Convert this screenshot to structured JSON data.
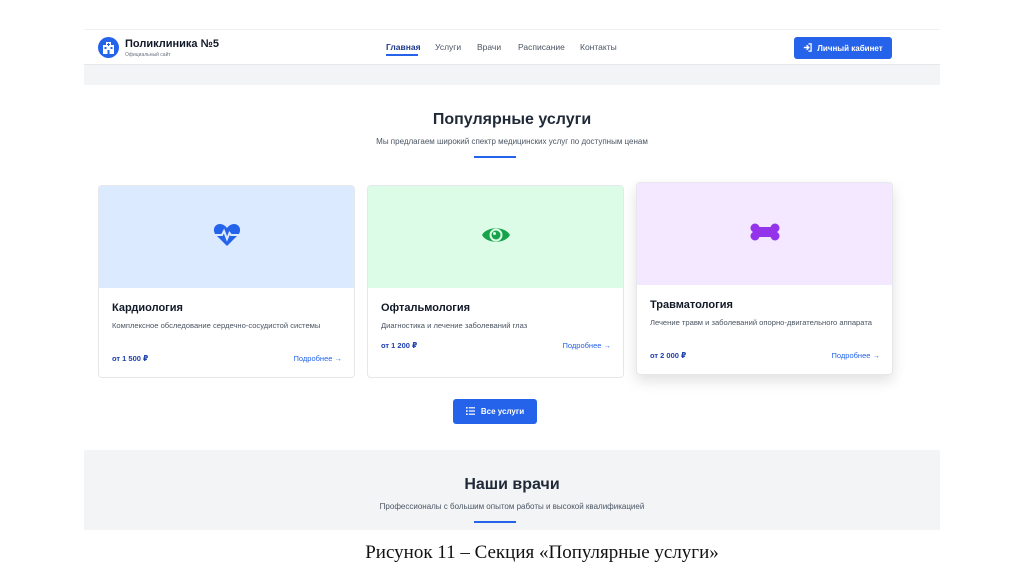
{
  "header": {
    "logo_title": "Поликлиника №5",
    "logo_subtitle": "Официальный сайт",
    "nav": [
      {
        "label": "Главная",
        "active": true
      },
      {
        "label": "Услуги",
        "active": false
      },
      {
        "label": "Врачи",
        "active": false
      },
      {
        "label": "Расписание",
        "active": false
      },
      {
        "label": "Контакты",
        "active": false
      }
    ],
    "cabinet_label": "Личный кабинет"
  },
  "services": {
    "title": "Популярные услуги",
    "subtitle": "Мы предлагаем широкий спектр медицинских услуг по доступным ценам",
    "cards": [
      {
        "title": "Кардиология",
        "description": "Комплексное обследование сердечно-сосудистой системы",
        "price": "от 1 500 ₽",
        "more": "Подробнее →",
        "icon": "heartbeat-icon",
        "bg_color": "#dbeafe",
        "icon_color": "#2563eb"
      },
      {
        "title": "Офтальмология",
        "description": "Диагностика и лечение заболеваний глаз",
        "price": "от 1 200 ₽",
        "more": "Подробнее →",
        "icon": "eye-icon",
        "bg_color": "#dcfce7",
        "icon_color": "#16a34a"
      },
      {
        "title": "Травматология",
        "description": "Лечение травм и заболеваний опорно-двигательного аппарата",
        "price": "от 2 000 ₽",
        "more": "Подробнее →",
        "icon": "bone-icon",
        "bg_color": "#f3e8ff",
        "icon_color": "#9333ea"
      }
    ],
    "all_button": "Все услуги"
  },
  "doctors": {
    "title": "Наши врачи",
    "subtitle": "Профессионалы с большим опытом работы и высокой квалификацией"
  },
  "caption": "Рисунок 11 – Секция «Популярные услуги»",
  "colors": {
    "accent": "#2563eb",
    "section_bg": "#f3f4f6"
  }
}
